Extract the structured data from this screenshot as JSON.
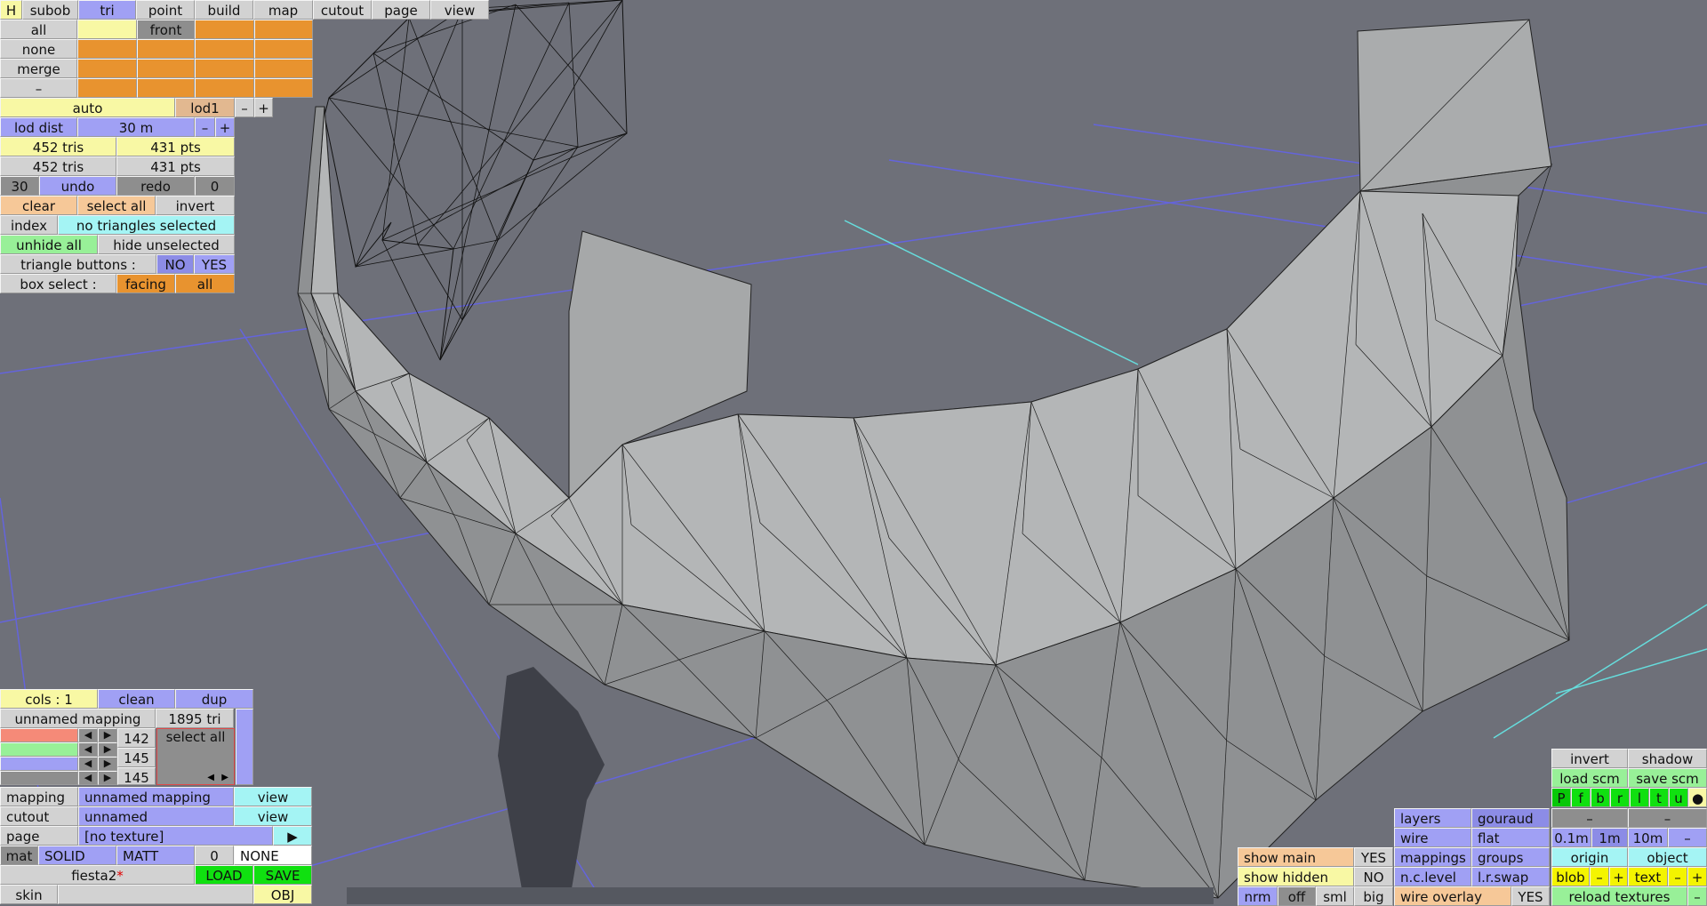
{
  "top_tabs": [
    "H",
    "subob",
    "tri",
    "point",
    "build",
    "map",
    "cutout",
    "page",
    "view"
  ],
  "sel": {
    "all": "all",
    "front": "front",
    "none": "none",
    "merge": "merge",
    "dash": "–"
  },
  "lod": {
    "auto": "auto",
    "lod1": "lod1",
    "minus": "–",
    "plus": "+",
    "dist_label": "lod dist",
    "dist_value": "30 m"
  },
  "counts": {
    "tris1": "452 tris",
    "pts1": "431 pts",
    "tris2": "452 tris",
    "pts2": "431 pts"
  },
  "history": {
    "undo_count": "30",
    "undo": "undo",
    "redo": "redo",
    "redo_count": "0"
  },
  "selection": {
    "clear": "clear",
    "select_all": "select all",
    "invert": "invert",
    "index": "index",
    "status": "no triangles selected",
    "unhide_all": "unhide all",
    "hide_unselected": "hide unselected",
    "tri_buttons_label": "triangle buttons :",
    "no": "NO",
    "yes": "YES",
    "box_select_label": "box select :",
    "facing": "facing",
    "all": "all"
  },
  "mapping_panel": {
    "cols": "cols : 1",
    "clean": "clean",
    "dup": "dup",
    "mapping_name": "unnamed mapping",
    "tri_count": "1895 tri",
    "r": "142",
    "g": "145",
    "b": "145",
    "select_all": "select all",
    "left": "◀",
    "right": "▶",
    "mapping_label": "mapping",
    "mapping_value": "unnamed mapping",
    "view": "view",
    "cutout_label": "cutout",
    "cutout_value": "unnamed",
    "page_label": "page",
    "page_value": "[no texture]",
    "mat": "mat",
    "solid": "SOLID",
    "matt": "MATT",
    "mat_num": "0",
    "none": "NONE",
    "file": "fiesta2",
    "modified": "*",
    "load": "LOAD",
    "save": "SAVE",
    "skin": "skin",
    "obj": "OBJ"
  },
  "view_panel": {
    "invert": "invert",
    "shadow": "shadow",
    "load_scm": "load scm",
    "save_scm": "save scm",
    "views": [
      "P",
      "f",
      "b",
      "r",
      "l",
      "t",
      "u",
      "●"
    ],
    "dash": "–",
    "layers": "layers",
    "gouraud": "gouraud",
    "wire": "wire",
    "flat": "flat",
    "grid": [
      "0.1m",
      "1m",
      "10m",
      "–"
    ],
    "mappings": "mappings",
    "groups": "groups",
    "origin": "origin",
    "object": "object",
    "show_main": "show main",
    "show_main_val": "YES",
    "show_hidden": "show hidden",
    "show_hidden_val": "NO",
    "nclevel": "n.c.level",
    "lrswap": "l.r.swap",
    "blob": "blob",
    "text": "text",
    "minus": "–",
    "plus": "+",
    "normals": [
      "nrm",
      "off",
      "sml",
      "big"
    ],
    "wire_overlay": "wire overlay",
    "wire_overlay_val": "YES",
    "reload": "reload textures"
  }
}
